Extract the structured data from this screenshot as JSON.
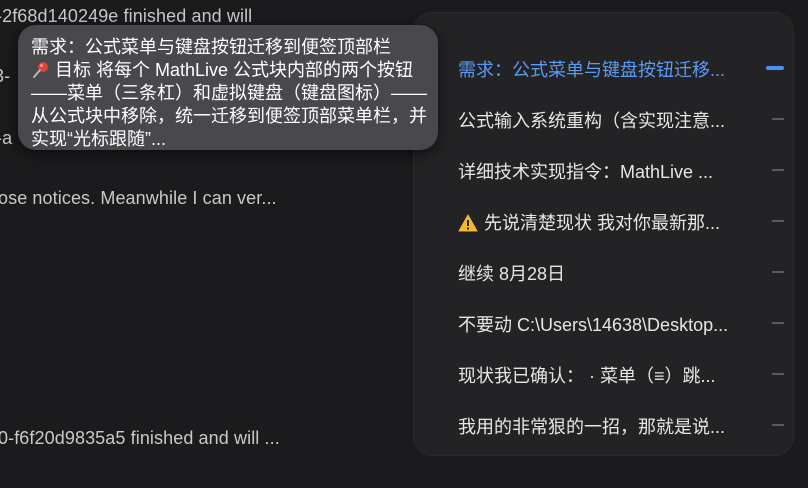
{
  "background_log": {
    "line1": "-2f68d140249e finished and will",
    "line2": "3-",
    "line3": "-a",
    "line4": "ose notices. Meanwhile I can ver...",
    "line5": "0-f6f20d9835a5 finished and will ..."
  },
  "tooltip": {
    "title": "需求：公式菜单与键盘按钮迁移到便签顶部栏",
    "pin_icon": "pushpin-icon",
    "body": "目标 将每个 MathLive 公式块内部的两个按钮——菜单（三条杠）和虚拟键盘（键盘图标）——从公式块中移除，统一迁移到便签顶部菜单栏，并实现“光标跟随”..."
  },
  "panel": {
    "accent_color": "#4c8ff0",
    "items": [
      {
        "label": "需求：公式菜单与键盘按钮迁移...",
        "active": true
      },
      {
        "label": "公式输入系统重构（含实现注意...",
        "active": false
      },
      {
        "label": "详细技术实现指令：MathLive ...",
        "active": false
      },
      {
        "label": "先说清楚现状 我对你最新那...",
        "active": false,
        "icon": "warning-icon"
      },
      {
        "label": "继续 8月28日",
        "active": false
      },
      {
        "label": "不要动 C:\\Users\\14638\\Desktop...",
        "active": false
      },
      {
        "label": "现状我已确认：  · 菜单（≡）跳...",
        "active": false
      },
      {
        "label": "我用的非常狠的一招，那就是说...",
        "active": false
      }
    ]
  }
}
